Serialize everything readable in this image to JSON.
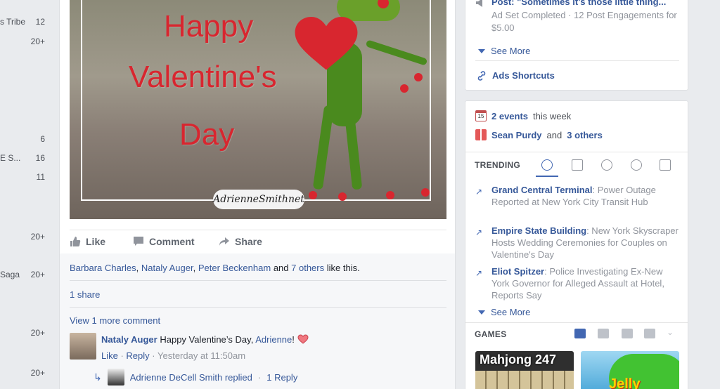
{
  "left_sidebar": [
    {
      "label": "s Tribe",
      "count": "12"
    },
    {
      "label": "",
      "count": "20+"
    },
    {
      "label": "",
      "count": "6"
    },
    {
      "label": "E S...",
      "count": "16"
    },
    {
      "label": "",
      "count": "11"
    },
    {
      "label": "",
      "count": "20+"
    },
    {
      "label": "Saga",
      "count": "20+"
    },
    {
      "label": "",
      "count": "20+"
    },
    {
      "label": "",
      "count": "20+"
    }
  ],
  "post": {
    "image_text": {
      "line1": "Happy",
      "line2": "Valentine's",
      "line3": "Day",
      "watermark": "AdrienneSmithnet"
    },
    "actions": {
      "like": "Like",
      "comment": "Comment",
      "share": "Share"
    },
    "likes": {
      "names": [
        "Barbara Charles",
        "Nataly Auger",
        "Peter Beckenham"
      ],
      "and": "and",
      "others": "7 others",
      "suffix": "like this."
    },
    "shares": "1 share",
    "view_more_comments": "View 1 more comment",
    "comment": {
      "author": "Nataly Auger",
      "text": "Happy Valentine’s Day,",
      "mention": "Adrienne",
      "excl": "!",
      "like": "Like",
      "reply": "Reply",
      "time": "Yesterday at 11:50am"
    },
    "reply_summary": {
      "text": "Adrienne DeCell Smith replied",
      "count": "1 Reply"
    }
  },
  "ads_card": {
    "post_title": "Post: \"Sometimes it's those little thing...",
    "meta": "Ad Set Completed · 12 Post Engagements for $5.00",
    "see_more": "See More",
    "shortcuts": "Ads Shortcuts"
  },
  "events_card": {
    "events_count": "2 events",
    "events_suffix": "this week",
    "birthday_name": "Sean Purdy",
    "birthday_and": "and",
    "birthday_others": "3 others",
    "calendar_day": "15",
    "trending_label": "TRENDING",
    "trends": [
      {
        "title": "Grand Central Terminal",
        "desc": ": Power Outage Reported at New York City Transit Hub"
      },
      {
        "title": "Empire State Building",
        "desc": ": New York Skyscraper Hosts Wedding Ceremonies for Couples on Valentine's Day"
      },
      {
        "title": "Eliot Spitzer",
        "desc": ": Police Investigating Ex-New York Governor for Alleged Assault at Hotel, Reports Say"
      }
    ],
    "see_more": "See More",
    "games_label": "GAMES",
    "games": [
      {
        "name": "Mahjong 247"
      },
      {
        "name": "Jelly"
      }
    ]
  },
  "colors": {
    "link": "#365899",
    "accent": "#4267b2",
    "heart": "#d8262f",
    "page_bg": "#e9ebee"
  }
}
